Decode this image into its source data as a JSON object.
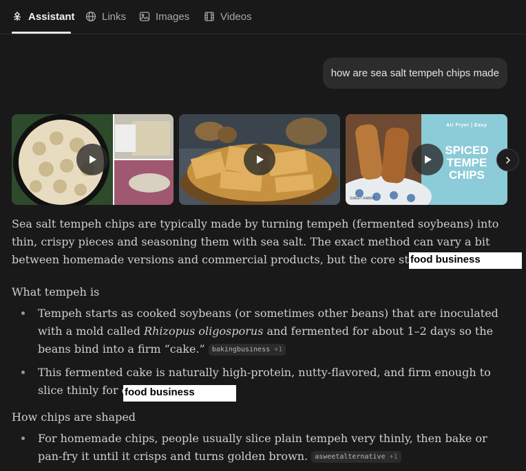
{
  "tabs": [
    {
      "label": "Assistant",
      "icon": "assistant-icon",
      "active": true
    },
    {
      "label": "Links",
      "icon": "globe-icon"
    },
    {
      "label": "Images",
      "icon": "image-icon"
    },
    {
      "label": "Videos",
      "icon": "film-icon"
    }
  ],
  "query": "how are sea salt tempeh chips made",
  "videos": [
    {
      "thumbnail": "tempeh chips in bowl and bags"
    },
    {
      "thumbnail": "fried tempeh chips on plate with tea set"
    },
    {
      "thumbnail": "spiced tempe chips",
      "overlay_small": "Air Fryer | Easy",
      "overlay_title": "SPICED TEMPE CHIPS",
      "watermark": "SWEET RABBIT"
    }
  ],
  "intro": "Sea salt tempeh chips are typically made by turning tempeh (fermented soybeans) into thin, crispy pieces and seasoning them with sea salt. The exact method can vary a bit between homemade versions and commercial products, but the core steps are similar.",
  "overlay_label": "food business",
  "sections": [
    {
      "heading": "What tempeh is",
      "bullets": [
        {
          "pre": "Tempeh starts as cooked soybeans (or sometimes other beans) that are inoculated with a mold called ",
          "italic": "Rhizopus oligosporus",
          "post": " and fermented for about 1–2 days so the beans bind into a firm “cake.”",
          "citation": "bakingbusiness",
          "citation_more": "+1"
        },
        {
          "text": "This fermented cake is naturally high-protein, nutty-flavored, and firm enough to slice thinly for chips."
        }
      ]
    },
    {
      "heading": "How chips are shaped",
      "bullets": [
        {
          "text": "For homemade chips, people usually slice plain tempeh very thinly, then bake or pan-fry it until it crisps and turns golden brown.",
          "citation": "asweetalternative",
          "citation_more": "+1"
        }
      ]
    }
  ],
  "colors": {
    "background": "#191919",
    "text": "#d2cfca",
    "accent": "#e6e6e6"
  }
}
